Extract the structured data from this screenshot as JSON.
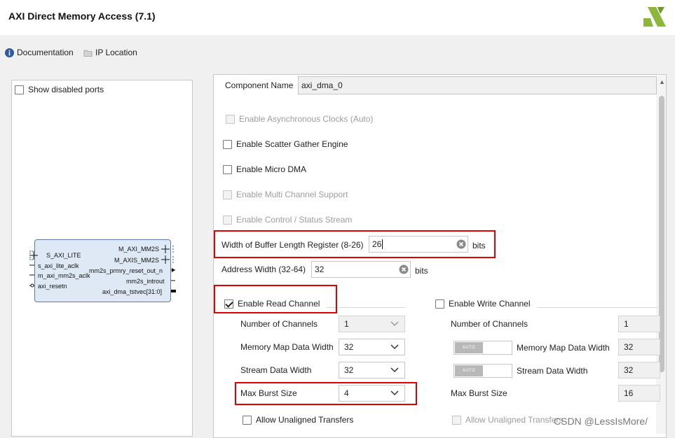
{
  "header": {
    "title": "AXI Direct Memory Access (7.1)"
  },
  "toolbar": {
    "documentation": "Documentation",
    "ip_location": "IP Location"
  },
  "left_panel": {
    "show_disabled_ports": "Show disabled ports",
    "block": {
      "left_ports": [
        "S_AXI_LITE",
        "s_axi_lite_aclk",
        "m_axi_mm2s_aclk",
        "axi_resetn"
      ],
      "right_ports": [
        "M_AXI_MM2S",
        "M_AXIS_MM2S",
        "mm2s_prmry_reset_out_n",
        "mm2s_introut",
        "axi_dma_tstvec[31:0]"
      ]
    }
  },
  "config": {
    "component_name_label": "Component Name",
    "component_name_value": "axi_dma_0",
    "enable_async_clocks": "Enable Asynchronous Clocks (Auto)",
    "enable_sg": "Enable Scatter Gather Engine",
    "enable_micro_dma": "Enable Micro DMA",
    "enable_multi_channel": "Enable Multi Channel Support",
    "enable_ctrl_status": "Enable Control / Status Stream",
    "buf_len_label": "Width of Buffer Length Register (8-26)",
    "buf_len_value": "26",
    "buf_len_unit": "bits",
    "addr_width_label": "Address Width (32-64)",
    "addr_width_value": "32",
    "addr_width_unit": "bits"
  },
  "read_channel": {
    "title": "Enable Read Channel",
    "num_channels_label": "Number of Channels",
    "num_channels_value": "1",
    "mm_data_width_label": "Memory Map Data Width",
    "mm_data_width_value": "32",
    "stream_data_width_label": "Stream Data Width",
    "stream_data_width_value": "32",
    "max_burst_label": "Max Burst Size",
    "max_burst_value": "4",
    "unaligned_label": "Allow Unaligned Transfers"
  },
  "write_channel": {
    "title": "Enable Write Channel",
    "num_channels_label": "Number of Channels",
    "num_channels_value": "1",
    "toggle_label": "AUTO",
    "mm_data_width_label": "Memory Map Data Width",
    "mm_data_width_value": "32",
    "stream_data_width_label": "Stream Data Width",
    "stream_data_width_value": "32",
    "max_burst_label": "Max Burst Size",
    "max_burst_value": "16",
    "unaligned_label": "Allow Unaligned Transfers"
  },
  "watermark": "CSDN @LessIsMore/",
  "colors": {
    "highlight": "#e00000",
    "block_fill": "#dfe9f5",
    "logo": "#8cb63c"
  }
}
